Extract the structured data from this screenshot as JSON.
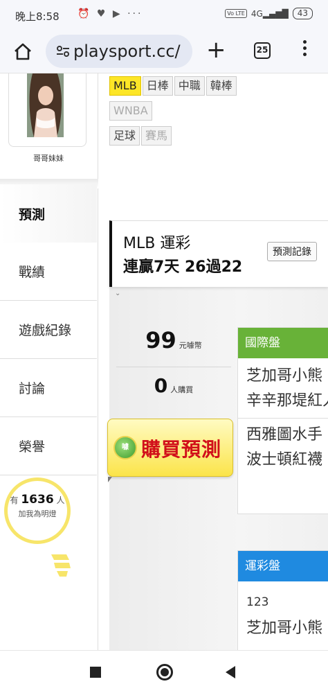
{
  "status_bar": {
    "time": "晚上8:58",
    "icons": "⏰ ♥ ▶ ···",
    "volte": "Vo LTE",
    "signal": "4G",
    "battery": "43"
  },
  "browser": {
    "url": "playsport.cc/",
    "tab_count": "25"
  },
  "profile": {
    "name": "哥哥妹妹"
  },
  "sidebar": {
    "items": [
      {
        "label": "預測"
      },
      {
        "label": "戰績"
      },
      {
        "label": "遊戲紀錄"
      },
      {
        "label": "討論"
      },
      {
        "label": "榮譽"
      }
    ],
    "fans_prefix": "有",
    "fans_count": "1636",
    "fans_suffix": "人",
    "fans_line2": "加我為明燈"
  },
  "tags": [
    {
      "label": "MLB"
    },
    {
      "label": "日棒"
    },
    {
      "label": "中職"
    },
    {
      "label": "韓棒"
    },
    {
      "label": "WNBA"
    },
    {
      "label": "足球"
    },
    {
      "label": "賽馬"
    }
  ],
  "record": {
    "title": "MLB 運彩",
    "streak": "連贏7天 26過22",
    "history_button": "預測記錄"
  },
  "purchase": {
    "price": "99",
    "price_unit": "元噱幣",
    "buyers": "0",
    "buyers_unit": "人購買",
    "buy_button": "購買預測",
    "buy_icon": "噱"
  },
  "markets": {
    "international": {
      "header": "國際盤",
      "games": [
        {
          "home": "芝加哥小熊",
          "away": "辛辛那堤紅人"
        },
        {
          "home": "西雅圖水手",
          "away": "波士頓紅襪"
        }
      ]
    },
    "sports_lottery": {
      "header": "運彩盤",
      "code": "123",
      "team": "芝加哥小熊"
    }
  },
  "colors": {
    "accent_yellow": "#fde627",
    "green_header": "#68b238",
    "blue_header": "#1f8ae0",
    "buy_text_red": "#d10f1a"
  }
}
